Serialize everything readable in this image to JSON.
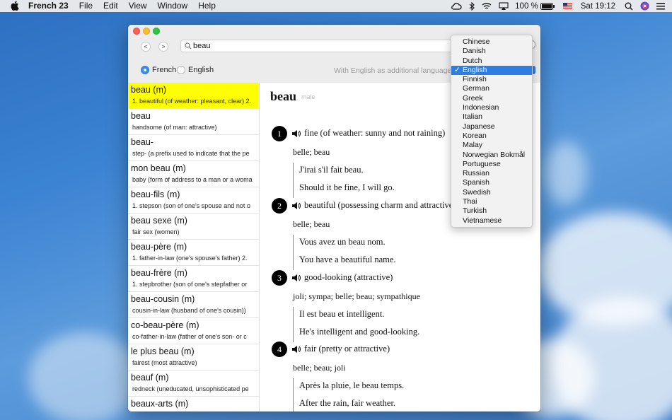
{
  "menubar": {
    "app_name": "French 23",
    "items": [
      "File",
      "Edit",
      "View",
      "Window",
      "Help"
    ],
    "battery": "100 %",
    "time": "Sat 19:12"
  },
  "search": {
    "value": "beau"
  },
  "language_toggle": {
    "french": "French",
    "english": "English",
    "selected": "French"
  },
  "additional_language_label": "With English as additional language",
  "entries": [
    {
      "head": "beau (m)",
      "sub": "1. beautiful (of weather: pleasant, clear) 2.",
      "selected": true
    },
    {
      "head": "beau",
      "sub": "handsome (of man: attractive)"
    },
    {
      "head": "beau-",
      "sub": "step- (a prefix used to indicate that the pe"
    },
    {
      "head": "mon beau (m)",
      "sub": "baby (form of address to a man or a woma"
    },
    {
      "head": "beau-fils (m)",
      "sub": "1. stepson (son of one's spouse and not o"
    },
    {
      "head": "beau sexe (m)",
      "sub": "fair sex (women)"
    },
    {
      "head": "beau-père (m)",
      "sub": "1. father-in-law (one's spouse's father) 2."
    },
    {
      "head": "beau-frère (m)",
      "sub": "1. stepbrother (son of one's stepfather or"
    },
    {
      "head": "beau-cousin (m)",
      "sub": "cousin-in-law (husband of one's cousin))"
    },
    {
      "head": "co-beau-père (m)",
      "sub": "co-father-in-law (father of one's son- or c"
    },
    {
      "head": "le plus beau (m)",
      "sub": "fairest (most attractive)"
    },
    {
      "head": "beauf (m)",
      "sub": "redneck (uneducated, unsophisticated pe"
    },
    {
      "head": "beaux-arts (m)",
      "sub": ""
    }
  ],
  "article": {
    "word": "beau",
    "gender": "male",
    "senses": [
      {
        "num": "1",
        "def": "fine (of weather: sunny and not raining)",
        "syn": "belle; beau",
        "ex_fr": "J'irai s'il fait beau.",
        "ex_en": "Should it be fine, I will go."
      },
      {
        "num": "2",
        "def": "beautiful (possessing charm and attractive)",
        "syn": "belle; beau",
        "ex_fr": "Vous avez un beau nom.",
        "ex_en": "You have a beautiful name."
      },
      {
        "num": "3",
        "def": "good-looking (attractive)",
        "syn": "joli; sympa; belle; beau; sympathique",
        "ex_fr": "Il est beau et intelligent.",
        "ex_en": "He's intelligent and good-looking."
      },
      {
        "num": "4",
        "def": "fair (pretty or attractive)",
        "syn": "belle; beau; joli",
        "ex_fr": "Après la pluie, le beau temps.",
        "ex_en": "After the rain, fair weather."
      }
    ]
  },
  "language_menu": {
    "items": [
      "Chinese",
      "Danish",
      "Dutch",
      "English",
      "Finnish",
      "German",
      "Greek",
      "Indonesian",
      "Italian",
      "Japanese",
      "Korean",
      "Malay",
      "Norwegian Bokmål",
      "Portuguese",
      "Russian",
      "Spanish",
      "Swedish",
      "Thai",
      "Turkish",
      "Vietnamese"
    ],
    "selected": "English",
    "check": "✓"
  },
  "colors": {
    "highlight": "#ffff00",
    "accent": "#2f7de1"
  }
}
